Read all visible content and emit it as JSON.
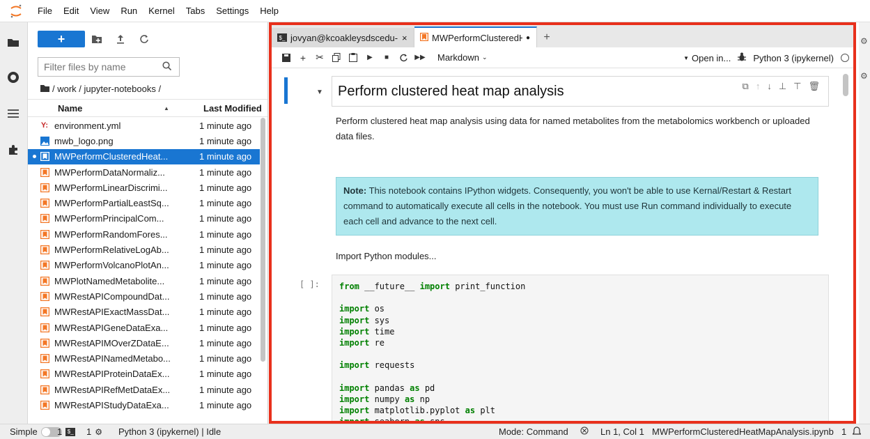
{
  "menubar": {
    "items": [
      "File",
      "Edit",
      "View",
      "Run",
      "Kernel",
      "Tabs",
      "Settings",
      "Help"
    ]
  },
  "colors": {
    "accent": "#1976d2",
    "highlight_border": "#e8301c",
    "note_bg": "#aee8ee",
    "keyword": "#008000"
  },
  "sidebar": {
    "icons": [
      "folder-icon",
      "running-icon",
      "toc-icon",
      "extension-icon"
    ]
  },
  "filebrowser": {
    "new_label": "+",
    "search_placeholder": "Filter files by name",
    "breadcrumb": "/ work / jupyter-notebooks /",
    "header_name": "Name",
    "header_modified": "Last Modified",
    "files": [
      {
        "name": "environment.yml",
        "modified": "1 minute ago",
        "icon": "yaml-icon"
      },
      {
        "name": "mwb_logo.png",
        "modified": "1 minute ago",
        "icon": "image-icon"
      },
      {
        "name": "MWPerformClusteredHeat...",
        "modified": "1 minute ago",
        "icon": "notebook-icon",
        "selected": true
      },
      {
        "name": "MWPerformDataNormaliz...",
        "modified": "1 minute ago",
        "icon": "notebook-icon"
      },
      {
        "name": "MWPerformLinearDiscrimi...",
        "modified": "1 minute ago",
        "icon": "notebook-icon"
      },
      {
        "name": "MWPerformPartialLeastSq...",
        "modified": "1 minute ago",
        "icon": "notebook-icon"
      },
      {
        "name": "MWPerformPrincipalCom...",
        "modified": "1 minute ago",
        "icon": "notebook-icon"
      },
      {
        "name": "MWPerformRandomFores...",
        "modified": "1 minute ago",
        "icon": "notebook-icon"
      },
      {
        "name": "MWPerformRelativeLogAb...",
        "modified": "1 minute ago",
        "icon": "notebook-icon"
      },
      {
        "name": "MWPerformVolcanoPlotAn...",
        "modified": "1 minute ago",
        "icon": "notebook-icon"
      },
      {
        "name": "MWPlotNamedMetabolite...",
        "modified": "1 minute ago",
        "icon": "notebook-icon"
      },
      {
        "name": "MWRestAPICompoundDat...",
        "modified": "1 minute ago",
        "icon": "notebook-icon"
      },
      {
        "name": "MWRestAPIExactMassDat...",
        "modified": "1 minute ago",
        "icon": "notebook-icon"
      },
      {
        "name": "MWRestAPIGeneDataExa...",
        "modified": "1 minute ago",
        "icon": "notebook-icon"
      },
      {
        "name": "MWRestAPIMOverZDataE...",
        "modified": "1 minute ago",
        "icon": "notebook-icon"
      },
      {
        "name": "MWRestAPINamedMetabo...",
        "modified": "1 minute ago",
        "icon": "notebook-icon"
      },
      {
        "name": "MWRestAPIProteinDataEx...",
        "modified": "1 minute ago",
        "icon": "notebook-icon"
      },
      {
        "name": "MWRestAPIRefMetDataEx...",
        "modified": "1 minute ago",
        "icon": "notebook-icon"
      },
      {
        "name": "MWRestAPIStudyDataExa...",
        "modified": "1 minute ago",
        "icon": "notebook-icon"
      }
    ]
  },
  "tabs": [
    {
      "label": "jovyan@kcoakleysdscedu-:",
      "close": "×",
      "active": false
    },
    {
      "label": "MWPerformClusteredHeatM",
      "close": "●",
      "active": true
    }
  ],
  "toolbar": {
    "cell_type": "Markdown",
    "open_in": "Open in...",
    "kernel": "Python 3 (ipykernel)"
  },
  "notebook": {
    "heading": "Perform clustered heat map analysis",
    "intro": "Perform clustered heat map analysis using data for named metabolites from the metabolomics workbench or uploaded data files.",
    "note_label": "Note:",
    "note_text": " This notebook contains IPython widgets. Consequently, you won't be able to use Kernal/Restart & Restart command to automatically execute all cells in the notebook. You must use Run command individually to execute each cell and advance to the next cell.",
    "import_text": "Import Python modules...",
    "prompt": "[ ]:",
    "code_lines": [
      [
        [
          "kw",
          "from"
        ],
        [
          "t",
          " __future__ "
        ],
        [
          "kw",
          "import"
        ],
        [
          "t",
          " print_function"
        ]
      ],
      [],
      [
        [
          "kw",
          "import"
        ],
        [
          "t",
          " os"
        ]
      ],
      [
        [
          "kw",
          "import"
        ],
        [
          "t",
          " sys"
        ]
      ],
      [
        [
          "kw",
          "import"
        ],
        [
          "t",
          " time"
        ]
      ],
      [
        [
          "kw",
          "import"
        ],
        [
          "t",
          " re"
        ]
      ],
      [],
      [
        [
          "kw",
          "import"
        ],
        [
          "t",
          " requests"
        ]
      ],
      [],
      [
        [
          "kw",
          "import"
        ],
        [
          "t",
          " pandas "
        ],
        [
          "kw",
          "as"
        ],
        [
          "t",
          " pd"
        ]
      ],
      [
        [
          "kw",
          "import"
        ],
        [
          "t",
          " numpy "
        ],
        [
          "kw",
          "as"
        ],
        [
          "t",
          " np"
        ]
      ],
      [
        [
          "kw",
          "import"
        ],
        [
          "t",
          " matplotlib.pyplot "
        ],
        [
          "kw",
          "as"
        ],
        [
          "t",
          " plt"
        ]
      ],
      [
        [
          "kw",
          "import"
        ],
        [
          "t",
          " seaborn "
        ],
        [
          "kw",
          "as"
        ],
        [
          "t",
          " sns"
        ]
      ]
    ]
  },
  "statusbar": {
    "mode_label": "Simple",
    "count_a": "1",
    "count_b": "1",
    "kernel_status": "Python 3 (ipykernel) | Idle",
    "mode": "Mode: Command",
    "position": "Ln 1, Col 1",
    "filename": "MWPerformClusteredHeatMapAnalysis.ipynb",
    "notifications": "1"
  }
}
